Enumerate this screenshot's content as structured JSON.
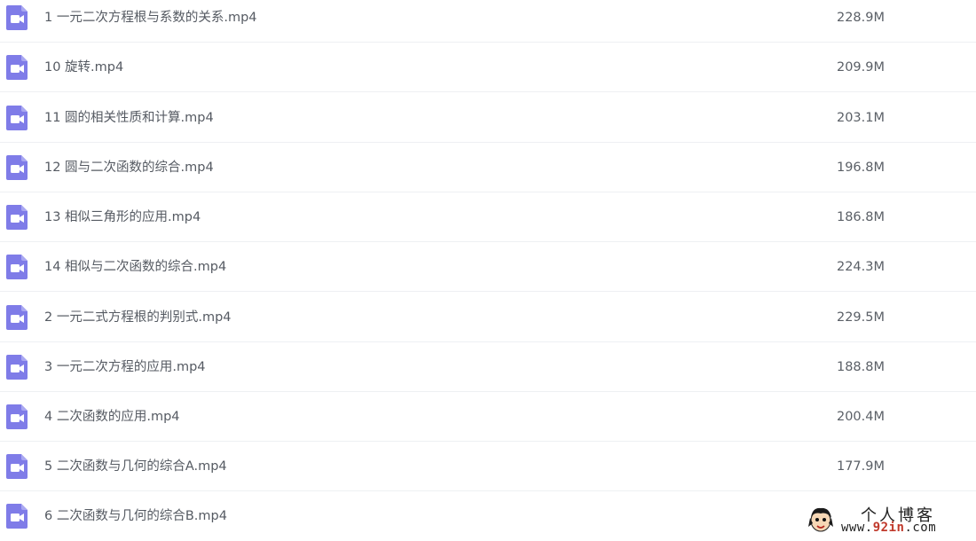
{
  "files": [
    {
      "name": "1 一元二次方程根与系数的关系.mp4",
      "size": "228.9M",
      "icon": "video-file-icon"
    },
    {
      "name": "10 旋转.mp4",
      "size": "209.9M",
      "icon": "video-file-icon"
    },
    {
      "name": "11 圆的相关性质和计算.mp4",
      "size": "203.1M",
      "icon": "video-file-icon"
    },
    {
      "name": "12 圆与二次函数的综合.mp4",
      "size": "196.8M",
      "icon": "video-file-icon"
    },
    {
      "name": "13 相似三角形的应用.mp4",
      "size": "186.8M",
      "icon": "video-file-icon"
    },
    {
      "name": "14 相似与二次函数的综合.mp4",
      "size": "224.3M",
      "icon": "video-file-icon"
    },
    {
      "name": "2 一元二式方程根的判别式.mp4",
      "size": "229.5M",
      "icon": "video-file-icon"
    },
    {
      "name": "3 一元二次方程的应用.mp4",
      "size": "188.8M",
      "icon": "video-file-icon"
    },
    {
      "name": "4 二次函数的应用.mp4",
      "size": "200.4M",
      "icon": "video-file-icon"
    },
    {
      "name": "5 二次函数与几何的综合A.mp4",
      "size": "177.9M",
      "icon": "video-file-icon"
    },
    {
      "name": "6 二次函数与几何的综合B.mp4",
      "size": "",
      "icon": "video-file-icon"
    }
  ],
  "watermark": {
    "title": "个人博客",
    "url_prefix": "www.",
    "url_accent": "92in",
    "url_suffix": ".com"
  },
  "colors": {
    "icon_purple": "#7f7ce8",
    "text": "#555a62",
    "divider": "#eef0f3"
  }
}
